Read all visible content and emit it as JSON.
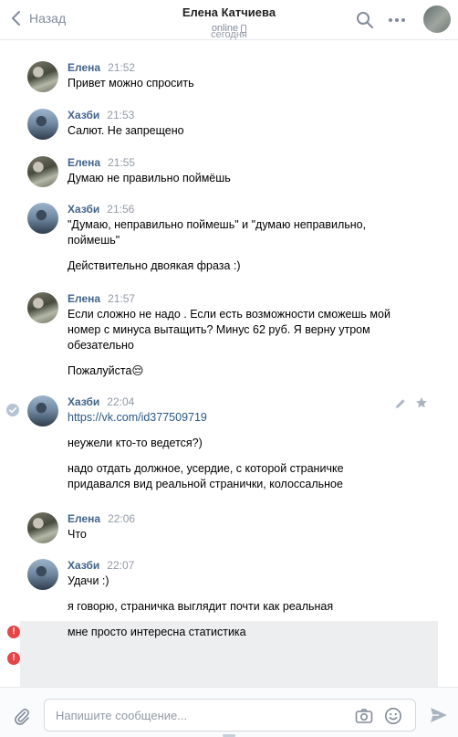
{
  "header": {
    "back_label": "Назад",
    "title": "Елена Катчиева",
    "status": "online",
    "date_separator": "сегодня"
  },
  "messages": [
    {
      "author": "Елена",
      "time": "21:52",
      "avatar": "elena",
      "lines": [
        "Привет можно спросить"
      ]
    },
    {
      "author": "Хазби",
      "time": "21:53",
      "avatar": "hazbi",
      "lines": [
        "Салют. Не запрещено"
      ]
    },
    {
      "author": "Елена",
      "time": "21:55",
      "avatar": "elena",
      "lines": [
        "Думаю не правильно поймёшь"
      ]
    },
    {
      "author": "Хазби",
      "time": "21:56",
      "avatar": "hazbi",
      "lines": [
        "\"Думаю, неправильно поймешь\" и \"думаю неправильно,",
        "поймешь\"",
        "Действительно двоякая фраза :)"
      ]
    },
    {
      "author": "Елена",
      "time": "21:57",
      "avatar": "elena",
      "lines": [
        "Если сложно не надо . Если есть возможности сможешь мой",
        "номер с минуса вытащить? Минус 62 руб. Я верну утром",
        "обезательно",
        "Пожалуйста😔"
      ]
    },
    {
      "author": "Хазби",
      "time": "22:04",
      "avatar": "hazbi",
      "lines": [
        "https://vk.com/id377509719",
        "неужели кто-то ведется?)",
        "надо отдать должное, усердие, с которой страничке",
        "придавался вид реальной странички, колоссальное"
      ]
    },
    {
      "author": "Елена",
      "time": "22:06",
      "avatar": "elena",
      "lines": [
        "Что"
      ]
    },
    {
      "author": "Хазби",
      "time": "22:07",
      "avatar": "hazbi",
      "lines": [
        "Удачи :)",
        "я говорю, страничка выглядит почти как реальная"
      ]
    }
  ],
  "unsent": {
    "text": "мне просто интересна статистика",
    "error_mark": "!"
  },
  "composer": {
    "placeholder": "Напишите сообщение..."
  },
  "icons": {
    "back": "chevron-left-icon",
    "search": "search-icon",
    "more": "more-dots-icon",
    "check": "check-circle-icon",
    "edit": "pencil-icon",
    "star": "star-icon",
    "attach": "paperclip-icon",
    "camera": "camera-icon",
    "emoji": "smile-icon",
    "send": "send-icon"
  },
  "colors": {
    "author_name": "#42648b",
    "link": "#2a5885",
    "muted": "#939aa5",
    "error": "#e64646",
    "unsent_bg": "#edeef0"
  }
}
